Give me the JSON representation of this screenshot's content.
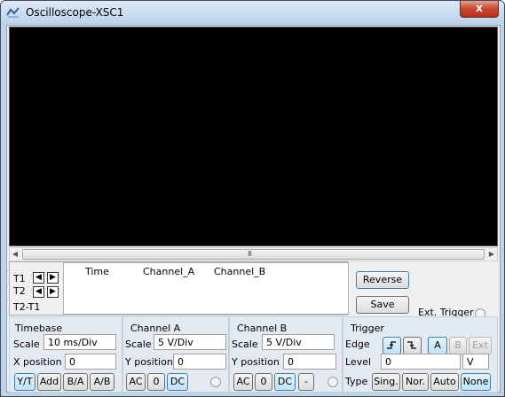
{
  "window": {
    "title": "Oscilloscope-XSC1",
    "close_icon": "close-icon",
    "close_glyph": "x",
    "app_icon": "oscilloscope-icon"
  },
  "cursors": {
    "t1": "T1",
    "t2": "T2",
    "t2t1": "T2-T1",
    "left_glyph": "◀",
    "right_glyph": "▶"
  },
  "readout": {
    "columns": [
      "Time",
      "Channel_A",
      "Channel_B"
    ]
  },
  "actions": {
    "reverse": "Reverse",
    "save": "Save",
    "ext_trigger": "Ext. Trigger"
  },
  "timebase": {
    "title": "Timebase",
    "scale_label": "Scale",
    "scale_value": "10 ms/Div",
    "xpos_label": "X position",
    "xpos_value": "0",
    "modes": [
      "Y/T",
      "Add",
      "B/A",
      "A/B"
    ],
    "selected": "Y/T"
  },
  "channel_a": {
    "title": "Channel A",
    "scale_label": "Scale",
    "scale_value": "5  V/Div",
    "ypos_label": "Y position",
    "ypos_value": "0",
    "coupling": [
      "AC",
      "0",
      "DC"
    ],
    "selected": "DC"
  },
  "channel_b": {
    "title": "Channel B",
    "scale_label": "Scale",
    "scale_value": "5  V/Div",
    "ypos_label": "Y position",
    "ypos_value": "0",
    "coupling": [
      "AC",
      "0",
      "DC",
      "-"
    ],
    "selected": "DC"
  },
  "trigger": {
    "title": "Trigger",
    "edge_label": "Edge",
    "edge_rising": "rising-edge-icon",
    "edge_falling": "falling-edge-icon",
    "sources": [
      "A",
      "B",
      "Ext"
    ],
    "selected_source": "A",
    "level_label": "Level",
    "level_value": "0",
    "level_unit": "V",
    "type_label": "Type",
    "types": [
      "Sing.",
      "Nor.",
      "Auto",
      "None"
    ],
    "selected_type": "None"
  },
  "scrollbar": {
    "left_glyph": "◀",
    "right_glyph": "▶",
    "grip_glyph": "III"
  }
}
